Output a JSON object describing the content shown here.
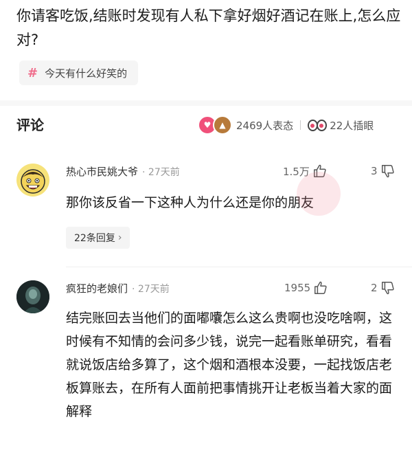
{
  "question": {
    "title": "你请客吃饭,结账时发现有人私下拿好烟好酒记在账上,怎么应对?",
    "topic_tag": "今天有什么好笑的"
  },
  "comments_header": {
    "label": "评论",
    "reaction_count": "2469人表态",
    "interrupt_count": "22人插眼"
  },
  "comments": [
    {
      "username": "热心市民姚大爷",
      "time": "· 27天前",
      "likes": "1.5万",
      "dislikes": "3",
      "text": "那你该反省一下这种人为什么还是你的朋友",
      "replies": "22条回复"
    },
    {
      "username": "疯狂的老娘们",
      "time": "· 27天前",
      "likes": "1955",
      "dislikes": "2",
      "text": "结完账回去当他们的面嘟囔怎么这么贵啊也没吃啥啊，这时候有不知情的会问多少钱，说完一起看账单研究，看看就说饭店给多算了，这个烟和酒根本没要，一起找饭店老板算账去，在所有人面前把事情挑开让老板当着大家的面解释"
    }
  ],
  "colors": {
    "accent": "#f06c8b",
    "text": "#1a1a1a",
    "meta": "#999999"
  },
  "icons": [
    "hashtag-icon",
    "love-reaction-icon",
    "hat-reaction-icon",
    "eyes-icon",
    "thumb-up-icon",
    "thumb-down-icon",
    "chevron-right-icon"
  ]
}
